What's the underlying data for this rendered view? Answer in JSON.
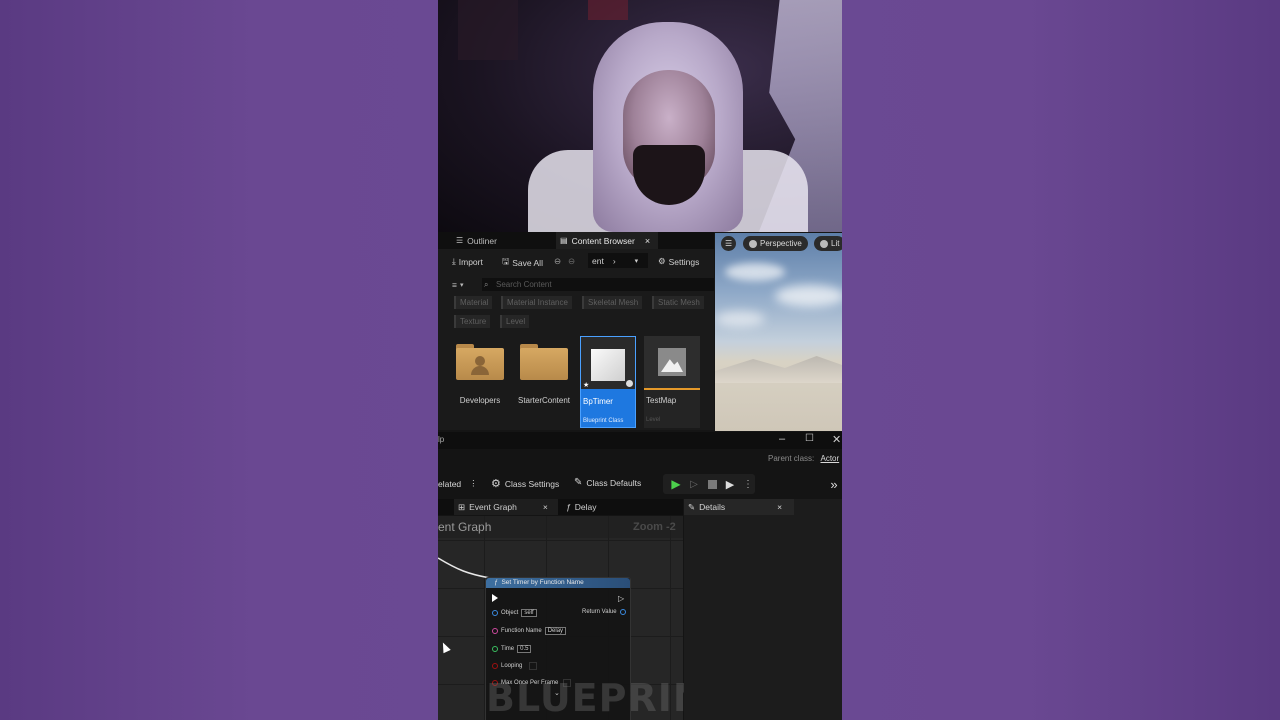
{
  "content_browser": {
    "tabs": [
      {
        "label": "Outliner",
        "icon": "outliner-icon"
      },
      {
        "label": "Content Browser",
        "icon": "content-browser-icon"
      }
    ],
    "toolbar": {
      "import_label": "Import",
      "save_all_label": "Save All",
      "path_label": "ent",
      "settings_label": "Settings"
    },
    "search": {
      "placeholder": "Search Content"
    },
    "filters": [
      "Material",
      "Material Instance",
      "Skeletal Mesh",
      "Static Mesh",
      "Texture",
      "Level"
    ],
    "assets": [
      {
        "label": "Developers",
        "sub": "",
        "kind": "folder-user"
      },
      {
        "label": "StarterContent",
        "sub": "",
        "kind": "folder"
      },
      {
        "label": "BpTimer",
        "sub": "Blueprint Class",
        "kind": "blueprint",
        "selected": true
      },
      {
        "label": "TestMap",
        "sub": "Level",
        "kind": "level"
      }
    ]
  },
  "viewport": {
    "perspective_label": "Perspective",
    "lit_label": "Lit"
  },
  "blueprint": {
    "title_fragment": "lp",
    "parent_class_label": "Parent class:",
    "parent_class_value": "Actor",
    "toolbar": {
      "related_label": "elated",
      "class_settings_label": "Class Settings",
      "class_defaults_label": "Class Defaults"
    },
    "tabs": [
      {
        "label": "Event Graph"
      },
      {
        "label": "Delay"
      }
    ],
    "graph_title": "ent Graph",
    "zoom_label": "Zoom -2",
    "details_label": "Details",
    "watermark": "BLUEPRINT",
    "node": {
      "title": "Set Timer by Function Name",
      "return_label": "Return Value",
      "pins": [
        {
          "label": "Object",
          "value": "self"
        },
        {
          "label": "Function Name",
          "value": "Delay"
        },
        {
          "label": "Time",
          "value": "0.5"
        },
        {
          "label": "Looping",
          "value": ""
        },
        {
          "label": "Max Once Per Frame",
          "value": ""
        }
      ]
    }
  }
}
